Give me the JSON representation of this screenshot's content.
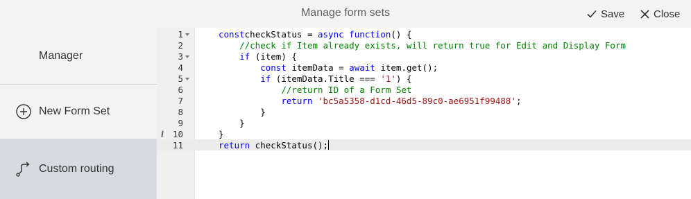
{
  "header": {
    "title": "Manage form sets",
    "save_label": "Save",
    "close_label": "Close"
  },
  "sidebar": {
    "items": [
      {
        "label": "Manager",
        "icon": ""
      },
      {
        "label": "New Form Set",
        "icon": "plus-circle-icon"
      },
      {
        "label": "Custom routing",
        "icon": "routing-icon",
        "selected": true
      }
    ]
  },
  "editor": {
    "language": "javascript",
    "active_line": 11,
    "lines": [
      {
        "num": "1",
        "fold": true,
        "info": false,
        "tokens": [
          [
            "kw",
            "const"
          ],
          [
            "",
            "checkStatus = "
          ],
          [
            "kw",
            "async"
          ],
          [
            "",
            ""
          ],
          [
            "kw",
            " function"
          ],
          [
            "",
            "() {"
          ]
        ]
      },
      {
        "num": "2",
        "fold": false,
        "info": false,
        "tokens": [
          [
            "",
            "    "
          ],
          [
            "cm",
            "//check if Item already exists, will return true for Edit and Display Form"
          ]
        ]
      },
      {
        "num": "3",
        "fold": true,
        "info": false,
        "tokens": [
          [
            "",
            "    "
          ],
          [
            "kw",
            "if"
          ],
          [
            "",
            " (item) {"
          ]
        ]
      },
      {
        "num": "4",
        "fold": false,
        "info": false,
        "tokens": [
          [
            "",
            "        "
          ],
          [
            "kw",
            "const"
          ],
          [
            "",
            " itemData = "
          ],
          [
            "kw",
            "await"
          ],
          [
            "",
            " item.get();"
          ]
        ]
      },
      {
        "num": "5",
        "fold": true,
        "info": false,
        "tokens": [
          [
            "",
            "        "
          ],
          [
            "kw",
            "if"
          ],
          [
            "",
            " (itemData.Title === "
          ],
          [
            "str",
            "'1'"
          ],
          [
            "",
            ") {"
          ]
        ]
      },
      {
        "num": "6",
        "fold": false,
        "info": false,
        "tokens": [
          [
            "",
            "            "
          ],
          [
            "cm",
            "//return ID of a Form Set"
          ]
        ]
      },
      {
        "num": "7",
        "fold": false,
        "info": false,
        "tokens": [
          [
            "",
            "            "
          ],
          [
            "kw",
            "return"
          ],
          [
            "",
            " "
          ],
          [
            "str",
            "'bc5a5358-d1cd-46d5-89c0-ae6951f99488'"
          ],
          [
            "",
            ";"
          ]
        ]
      },
      {
        "num": "8",
        "fold": false,
        "info": false,
        "tokens": [
          [
            "",
            "        }"
          ]
        ]
      },
      {
        "num": "9",
        "fold": false,
        "info": false,
        "tokens": [
          [
            "",
            "    }"
          ]
        ]
      },
      {
        "num": "10",
        "fold": false,
        "info": true,
        "tokens": [
          [
            "",
            "}"
          ]
        ]
      },
      {
        "num": "11",
        "fold": false,
        "info": false,
        "cursor": true,
        "tokens": [
          [
            "kw",
            "return"
          ],
          [
            "",
            " checkStatus();"
          ]
        ]
      }
    ],
    "info_marker": "i"
  }
}
